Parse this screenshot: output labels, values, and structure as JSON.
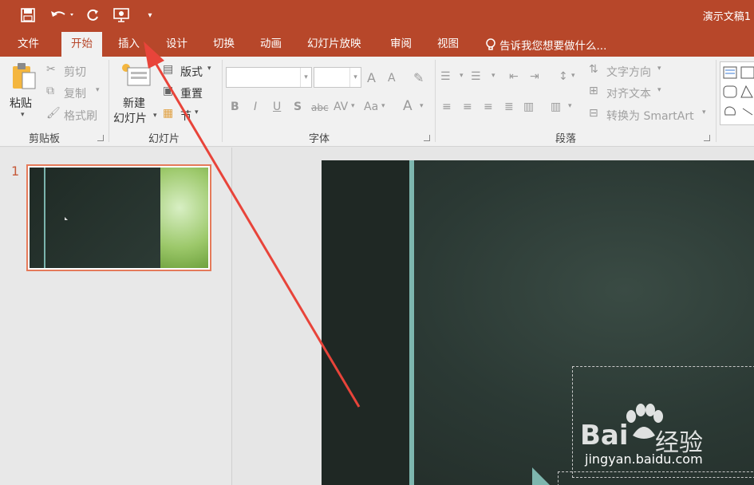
{
  "title_bar": {
    "doc_title": "演示文稿1",
    "qat": [
      {
        "icon": "save-icon"
      },
      {
        "icon": "undo-icon"
      },
      {
        "icon": "redo-icon"
      },
      {
        "icon": "present-from-start-icon"
      },
      {
        "icon": "customize-qat-icon"
      }
    ]
  },
  "tabs": [
    "文件",
    "开始",
    "插入",
    "设计",
    "切换",
    "动画",
    "幻灯片放映",
    "审阅",
    "视图"
  ],
  "active_tab": "开始",
  "tell_me": "告诉我您想要做什么...",
  "ribbon": {
    "clipboard": {
      "paste": "粘贴",
      "cut": "剪切",
      "copy": "复制",
      "format_painter": "格式刷",
      "label": "剪贴板"
    },
    "slides": {
      "new_slide_1": "新建",
      "new_slide_2": "幻灯片",
      "layout": "版式",
      "reset": "重置",
      "section": "节",
      "label": "幻灯片"
    },
    "font": {
      "font_name": "",
      "font_size": "",
      "bold": "B",
      "italic": "I",
      "underline": "U",
      "shadow": "S",
      "strike": "abc",
      "spacing": "AV",
      "case": "Aa",
      "color": "A",
      "grow": "A",
      "shrink": "A",
      "label": "字体"
    },
    "paragraph": {
      "text_direction": "文字方向",
      "align_text": "对齐文本",
      "smartart": "转换为 SmartArt",
      "label": "段落"
    }
  },
  "slide_panel": {
    "slide_number": "1"
  },
  "watermark": {
    "brand": "Bai",
    "brand_suffix": "经验",
    "url": "jingyan.baidu.com"
  },
  "colors": {
    "accent": "#b7472a",
    "arrow": "#e8443a",
    "slide_stripe": "#7db6ae"
  }
}
